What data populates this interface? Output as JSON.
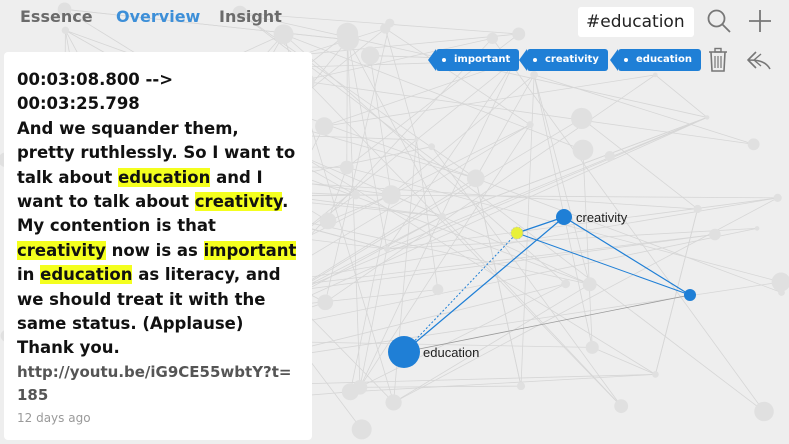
{
  "tabs": [
    {
      "label": "Essence",
      "active": false
    },
    {
      "label": "Overview",
      "active": true
    },
    {
      "label": "Insight",
      "active": false
    }
  ],
  "search": {
    "value": "#education #"
  },
  "toolbar": {
    "icons": [
      "search-icon",
      "plus-icon",
      "trash-icon",
      "undo-icon"
    ]
  },
  "filter_tags": [
    "important",
    "creativity",
    "education"
  ],
  "colors": {
    "accent": "#1f7fd6",
    "highlight": "#f4ff1e",
    "active_tab": "#3d8fd8",
    "yellow_node": "#e8f03a"
  },
  "statement": {
    "time_range": "00:03:08.800 --> 00:03:25.798",
    "segments": [
      {
        "text": "And we squander them, pretty ruthlessly. So I want to talk about ",
        "hl": false
      },
      {
        "text": "education",
        "hl": true
      },
      {
        "text": " and I want to talk about ",
        "hl": false
      },
      {
        "text": "creativity",
        "hl": true
      },
      {
        "text": ". My contention is that ",
        "hl": false
      },
      {
        "text": "creativity",
        "hl": true
      },
      {
        "text": " now is as ",
        "hl": false
      },
      {
        "text": "important",
        "hl": true
      },
      {
        "text": " in ",
        "hl": false
      },
      {
        "text": "education",
        "hl": true
      },
      {
        "text": " as literacy, and we should treat it with the same status. (Applause) Thank you.",
        "hl": false
      }
    ],
    "link": "http://youtu.be/iG9CE55wbtY?t=185",
    "age": "12 days ago"
  },
  "graph": {
    "node_labels": {
      "education": "education",
      "creativity": "creativity"
    }
  }
}
